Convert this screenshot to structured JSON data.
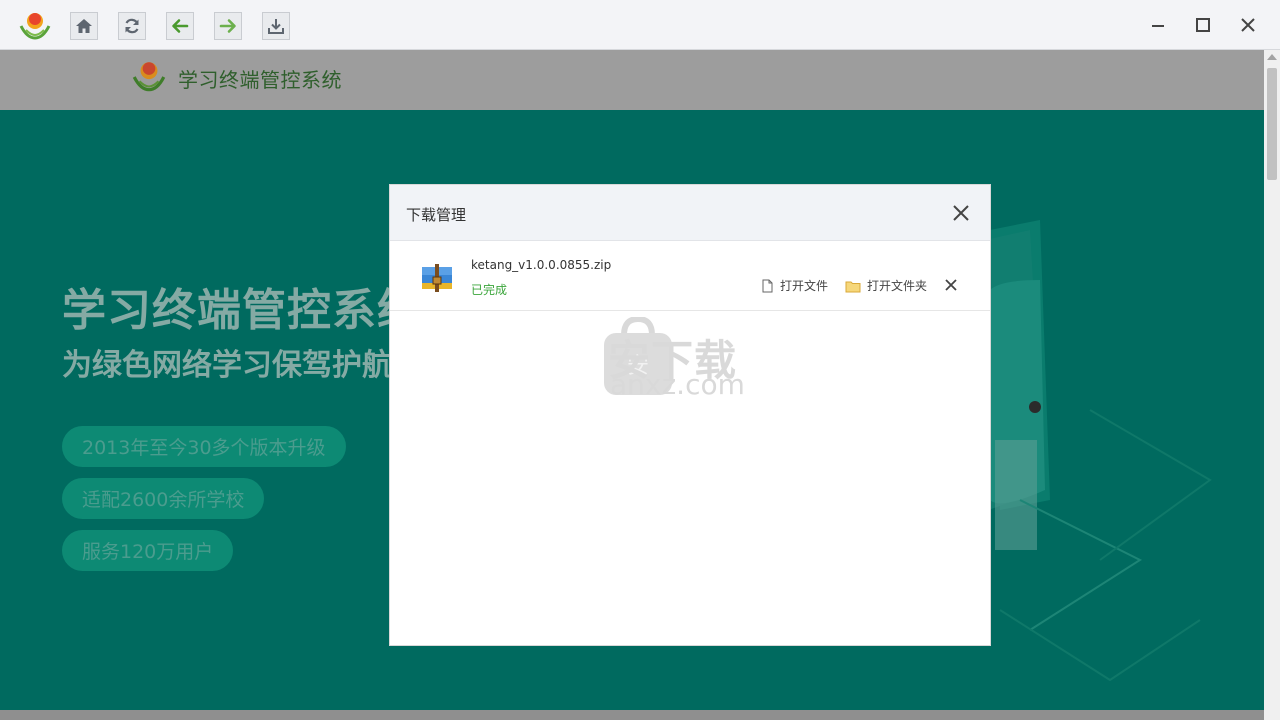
{
  "toolbar": {
    "buttons": [
      {
        "name": "home-icon"
      },
      {
        "name": "refresh-icon"
      },
      {
        "name": "back-arrow-icon"
      },
      {
        "name": "forward-arrow-icon"
      },
      {
        "name": "download-icon"
      }
    ]
  },
  "window_controls": [
    "minimize-icon",
    "maximize-icon",
    "close-icon"
  ],
  "site": {
    "title": "学习终端管控系统"
  },
  "banner": {
    "hero_title": "学习终端管控系统",
    "hero_subtitle": "为绿色网络学习保驾护航",
    "pills": [
      "2013年至今30多个版本升级",
      "适配2600余所学校",
      "服务120万用户"
    ]
  },
  "dialog": {
    "title": "下载管理",
    "items": [
      {
        "filename": "ketang_v1.0.0.0855.zip",
        "status": "已完成",
        "open_file_label": "打开文件",
        "open_folder_label": "打开文件夹"
      }
    ]
  },
  "watermark": {
    "cn": "安下载",
    "en": "anxz.com",
    "badge": "安"
  },
  "colors": {
    "banner_bg": "#006a5f",
    "status_green": "#3ba53b",
    "pill_bg": "#0d8a74"
  }
}
